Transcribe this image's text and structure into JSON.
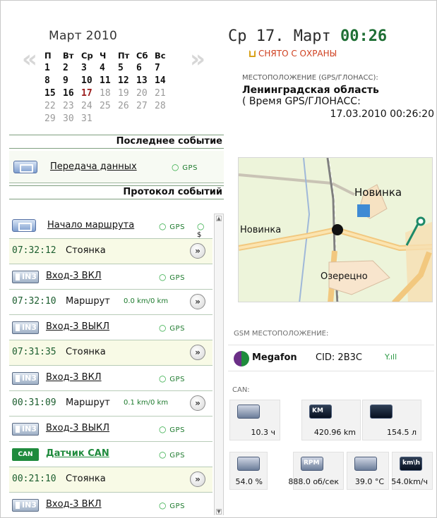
{
  "calendar": {
    "title": "Март 2010",
    "weekdays": [
      "П",
      "Вт",
      "Ср",
      "Ч",
      "Пт",
      "Сб",
      "Вс"
    ],
    "days": [
      [
        "1",
        "2",
        "3",
        "4",
        "5",
        "6",
        "7"
      ],
      [
        "8",
        "9",
        "10",
        "11",
        "12",
        "13",
        "14"
      ],
      [
        "15",
        "16",
        "17",
        "18",
        "19",
        "20",
        "21"
      ],
      [
        "22",
        "23",
        "24",
        "25",
        "26",
        "27",
        "28"
      ],
      [
        "29",
        "30",
        "31",
        "",
        "",
        "",
        ""
      ]
    ],
    "today": "17"
  },
  "last_event": {
    "header": "Последнее событие",
    "label": "Передача данных",
    "gps": "GPS"
  },
  "protocol": {
    "header": "Протокол событий",
    "rows": [
      {
        "type": "route-start",
        "label": "Начало маршрута",
        "gps": "GPS",
        "extra": "$"
      },
      {
        "type": "stop",
        "time": "07:32:12",
        "label": "Стоянка"
      },
      {
        "type": "in",
        "label": "Вход-3 ВКЛ",
        "gps": "GPS",
        "icon_text": "IN3"
      },
      {
        "type": "route",
        "time": "07:32:10",
        "label": "Маршрут",
        "speed": "0.0 km/0 km"
      },
      {
        "type": "in",
        "label": "Вход-3 ВЫКЛ",
        "gps": "GPS",
        "icon_text": "IN3"
      },
      {
        "type": "stop",
        "time": "07:31:35",
        "label": "Стоянка"
      },
      {
        "type": "in",
        "label": "Вход-3 ВКЛ",
        "gps": "GPS",
        "icon_text": "IN3"
      },
      {
        "type": "route",
        "time": "00:31:09",
        "label": "Маршрут",
        "speed": "0.1 km/0 km"
      },
      {
        "type": "in",
        "label": "Вход-3 ВЫКЛ",
        "gps": "GPS",
        "icon_text": "IN3"
      },
      {
        "type": "can",
        "label": "Датчик CAN",
        "gps": "GPS",
        "icon_text": "CAN"
      },
      {
        "type": "stop",
        "time": "00:21:10",
        "label": "Стоянка"
      },
      {
        "type": "in",
        "label": "Вход-3 ВКЛ",
        "gps": "GPS",
        "icon_text": "IN3"
      }
    ]
  },
  "status": {
    "weekday_date": "Ср 17. Март",
    "time": "00:26",
    "security": "СНЯТО С ОХРАНЫ"
  },
  "location": {
    "label": "МЕСТОПОЛОЖЕНИЕ (GPS/ГЛОНАСС):",
    "region": "Ленинградская область",
    "time_label": "( Время GPS/ГЛОНАСС:",
    "timestamp": "17.03.2010 00:26:20"
  },
  "map": {
    "labels": [
      "Новинка",
      "Новинка",
      "Озерецно"
    ]
  },
  "gsm": {
    "label": "GSM МЕСТОПОЛОЖЕНИЕ:",
    "operator": "Megafon",
    "cid": "CID: 2B3C",
    "signal": "Y.ıll"
  },
  "can": {
    "label": "CAN:",
    "tiles": [
      {
        "icon": "clock-icon",
        "value": "10.3 ч"
      },
      {
        "icon": "km-icon",
        "icon_text": "KM",
        "value": "420.96 km"
      },
      {
        "icon": "fuel-level-icon",
        "value": "154.5 л"
      },
      {
        "icon": "fuel-pump-icon",
        "value": "54.0 %"
      },
      {
        "icon": "rpm-icon",
        "icon_text": "RPM",
        "value": "888.0 об/сек"
      },
      {
        "icon": "thermometer-icon",
        "value": "39.0 °C"
      },
      {
        "icon": "speed-icon",
        "icon_text": "km\\h",
        "value": "54.0km/ч"
      }
    ]
  }
}
